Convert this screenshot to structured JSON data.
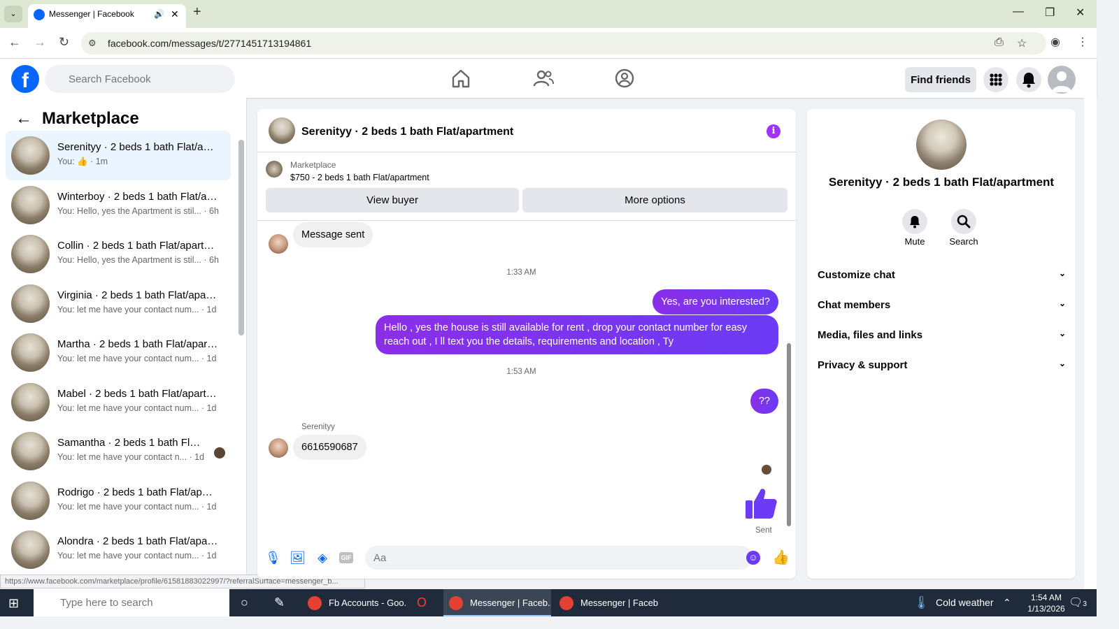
{
  "browser": {
    "tab_title": "Messenger | Facebook",
    "url": "facebook.com/messages/t/2771451713194861",
    "status_url": "https://www.facebook.com/marketplace/profile/61581883022997/?referralSurface=messenger_b..."
  },
  "fb": {
    "search_placeholder": "Search Facebook",
    "find_friends": "Find friends"
  },
  "sidebar": {
    "title": "Marketplace",
    "conversations": [
      {
        "name": "Serenityy · 2 beds 1 bath Flat/apartment",
        "preview_a": "You: ",
        "preview_b": " · 1m"
      },
      {
        "name": "Winterboy · 2 beds 1 bath Flat/apartment",
        "preview": "You: Hello, yes the Apartment is stil... · 6h"
      },
      {
        "name": "Collin · 2 beds 1 bath Flat/apartment",
        "preview": "You: Hello, yes the Apartment is stil... · 6h"
      },
      {
        "name": "Virginia · 2 beds 1 bath Flat/apartment",
        "preview": "You: let me have your contact num... · 1d"
      },
      {
        "name": "Martha · 2 beds 1 bath Flat/apartment",
        "preview": "You: let me have your contact num... · 1d"
      },
      {
        "name": "Mabel · 2 beds 1 bath Flat/apartment",
        "preview": "You: let me have your contact num... · 1d"
      },
      {
        "name": "Samantha · 2 beds 1 bath Flat/apartment",
        "preview": "You: let me have your contact n... · 1d"
      },
      {
        "name": "Rodrigo · 2 beds 1 bath Flat/apartment",
        "preview": "You: let me have your contact num... · 1d"
      },
      {
        "name": "Alondra · 2 beds 1 bath Flat/apartment",
        "preview": "You: let me have your contact num... · 1d"
      }
    ]
  },
  "chat": {
    "title": "Serenityy · 2 beds 1 bath Flat/apartment",
    "marketplace_label": "Marketplace",
    "listing": "$750 - 2 beds 1 bath Flat/apartment",
    "view_buyer": "View buyer",
    "more_options": "More options",
    "messages": {
      "m1": "Message sent",
      "t1": "1:33 AM",
      "m2": "Yes, are you interested?",
      "m3": "Hello , yes the house is still available for rent , drop your contact number for easy reach out , I ll text you the details, requirements and location , Ty",
      "t2": "1:53 AM",
      "m4": "??",
      "sender": "Serenityy",
      "m5": "6616590687",
      "sent": "Sent"
    },
    "composer_placeholder": "Aa"
  },
  "details": {
    "name": "Serenityy · 2 beds 1 bath Flat/apartment",
    "mute": "Mute",
    "search": "Search",
    "rows": [
      "Customize chat",
      "Chat members",
      "Media, files and links",
      "Privacy & support"
    ]
  },
  "taskbar": {
    "search_placeholder": "Type here to search",
    "items": [
      "Fb Accounts - Goo...",
      "Messenger | Faceb...",
      "Messenger | Faceb..."
    ],
    "weather": "Cold weather",
    "time": "1:54 AM",
    "date": "1/13/2026",
    "notif_count": "3"
  },
  "colors": {
    "accent": "#0866ff",
    "bubble_out": "#7b2fe4"
  }
}
